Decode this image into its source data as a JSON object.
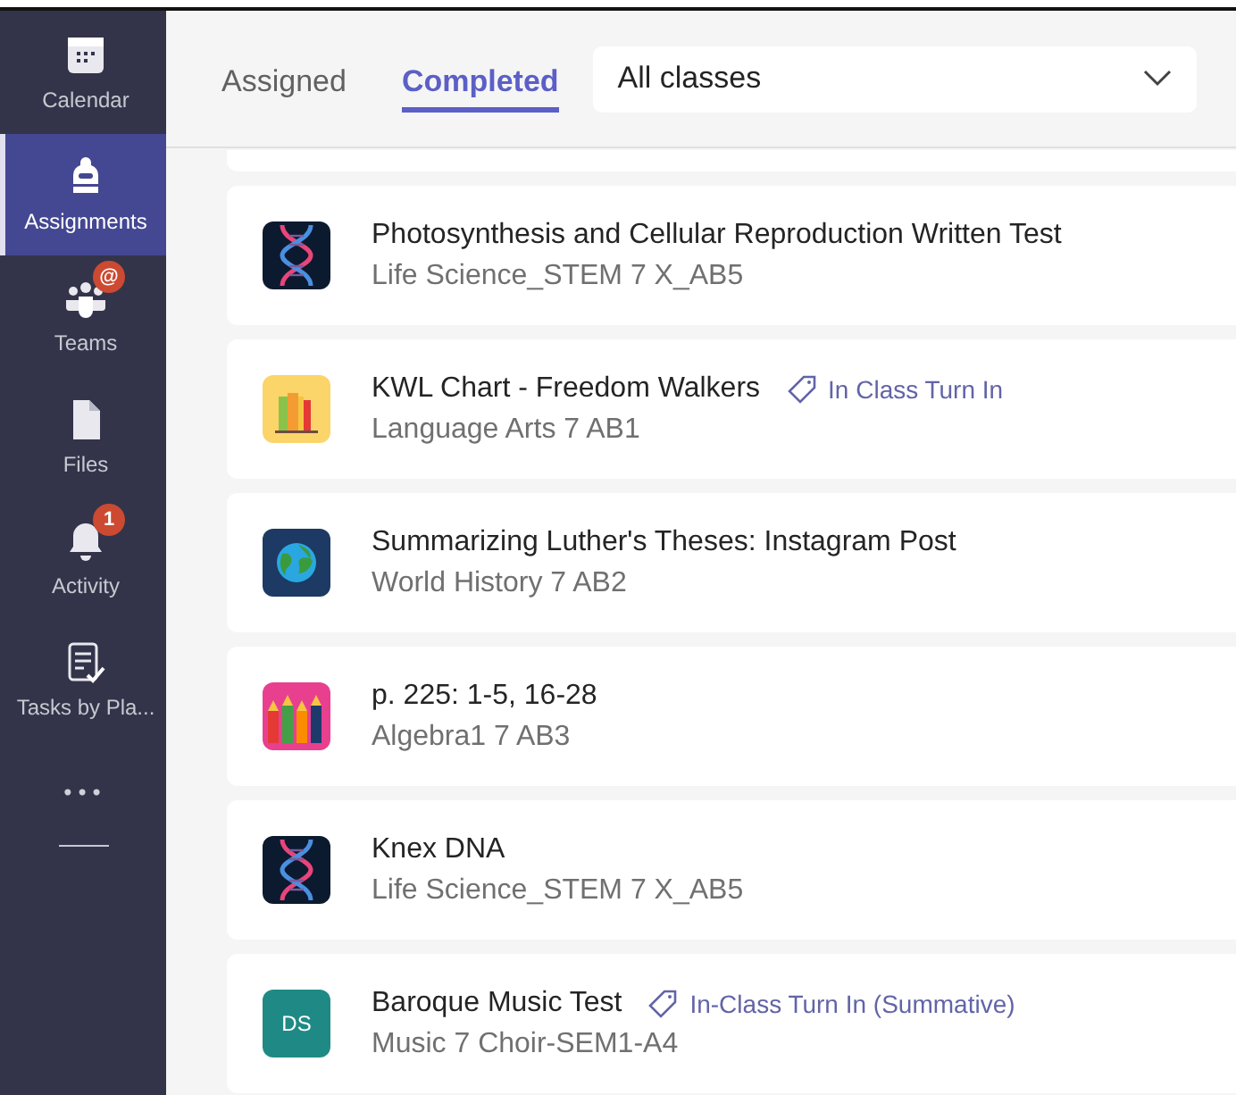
{
  "sidebar": {
    "items": [
      {
        "label": "Calendar",
        "selected": false
      },
      {
        "label": "Assignments",
        "selected": true
      },
      {
        "label": "Teams",
        "selected": false,
        "badge": "@"
      },
      {
        "label": "Files",
        "selected": false
      },
      {
        "label": "Activity",
        "selected": false,
        "badge": "1"
      },
      {
        "label": "Tasks by Pla...",
        "selected": false
      }
    ],
    "more": "•••"
  },
  "tabs": [
    {
      "label": "Assigned",
      "selected": false
    },
    {
      "label": "Completed",
      "selected": true
    }
  ],
  "class_filter": {
    "value": "All classes"
  },
  "assignments": [
    {
      "title": "Photosynthesis and Cellular Reproduction Written Test",
      "class": "Life Science_STEM 7 X_AB5",
      "kind": "dna"
    },
    {
      "title": "KWL Chart - Freedom Walkers",
      "class": "Language Arts 7 AB1",
      "kind": "books",
      "tag": "In Class Turn In"
    },
    {
      "title": "Summarizing Luther's Theses: Instagram Post",
      "class": "World History 7 AB2",
      "kind": "globe"
    },
    {
      "title": "p. 225: 1-5, 16-28",
      "class": "Algebra1 7 AB3",
      "kind": "pencils"
    },
    {
      "title": "Knex DNA",
      "class": "Life Science_STEM 7 X_AB5",
      "kind": "dna"
    },
    {
      "title": "Baroque Music Test",
      "class": "Music 7 Choir-SEM1-A4",
      "kind": "initials",
      "initials": "DS",
      "tag": "In-Class Turn In (Summative)"
    }
  ]
}
